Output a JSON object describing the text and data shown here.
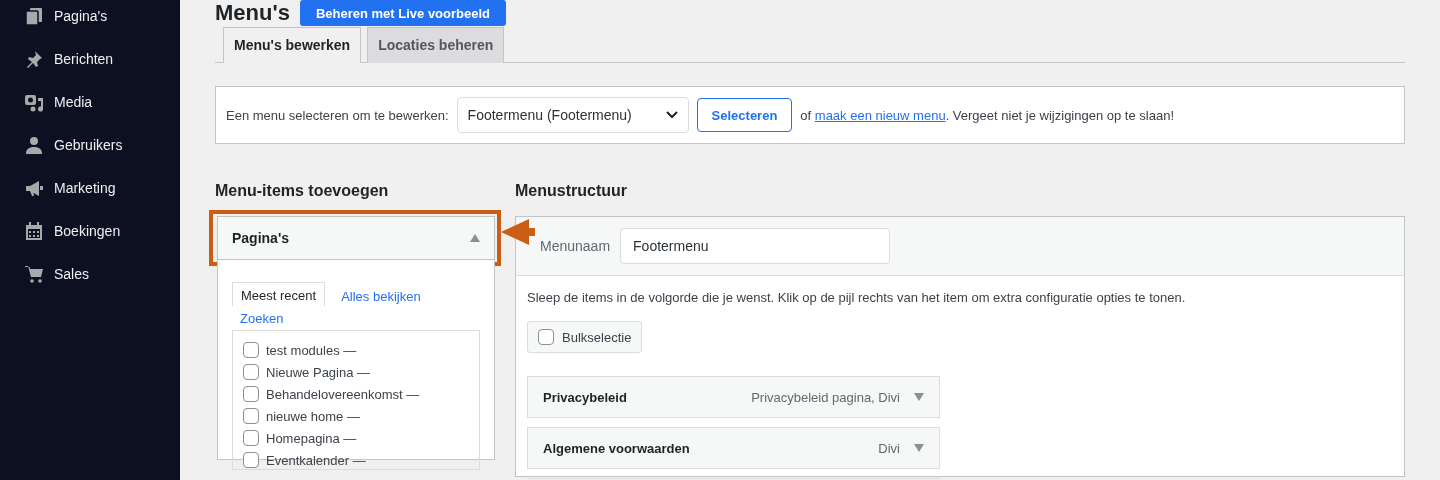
{
  "sidebar": {
    "items": [
      {
        "label": "Pagina's",
        "kind": "pages"
      },
      {
        "label": "Berichten",
        "kind": "pin"
      },
      {
        "label": "Media",
        "kind": "media"
      },
      {
        "label": "Gebruikers",
        "kind": "user"
      },
      {
        "label": "Marketing",
        "kind": "megaphone"
      },
      {
        "label": "Boekingen",
        "kind": "calendar"
      },
      {
        "label": "Sales",
        "kind": "cart"
      }
    ]
  },
  "page_title": "Menu's",
  "header_button": "Beheren met Live voorbeeld",
  "tabs": [
    {
      "label": "Menu's bewerken",
      "selected": true
    },
    {
      "label": "Locaties beheren",
      "selected": false
    }
  ],
  "select_bar": {
    "label": "Een menu selecteren om te bewerken:",
    "dropdown_value": "Footermenu (Footermenu)",
    "button": "Selecteren",
    "text_before_link": "of",
    "link": "maak een nieuw menu",
    "text_after_link": ". Vergeet niet je wijzigingen op te slaan!"
  },
  "add_items": {
    "title": "Menu-items toevoegen",
    "panel": {
      "title": "Pagina's",
      "expanded": true,
      "highlighted": true
    },
    "tabs": [
      {
        "label": "Meest recent",
        "selected": true
      },
      {
        "label": "Alles bekijken",
        "selected": false
      },
      {
        "label": "Zoeken",
        "selected": false
      }
    ],
    "pages": [
      {
        "label": "test modules —",
        "checked": false
      },
      {
        "label": "Nieuwe Pagina —",
        "checked": false
      },
      {
        "label": "Behandelovereenkomst —",
        "checked": false
      },
      {
        "label": "nieuwe home —",
        "checked": false
      },
      {
        "label": "Homepagina —",
        "checked": false
      },
      {
        "label": "Eventkalender —",
        "checked": false
      }
    ]
  },
  "structure": {
    "title": "Menustructuur",
    "name_label": "Menunaam",
    "name_value": "Footermenu",
    "instructions": "Sleep de items in de volgorde die je wenst. Klik op de pijl rechts van het item om extra configuratie opties te tonen.",
    "bulk": {
      "label": "Bulkselectie",
      "checked": false
    },
    "items": [
      {
        "title": "Privacybeleid",
        "meta": "Privacybeleid pagina, Divi",
        "expanded": false
      },
      {
        "title": "Algemene voorwaarden",
        "meta": "Divi",
        "expanded": false
      }
    ]
  }
}
